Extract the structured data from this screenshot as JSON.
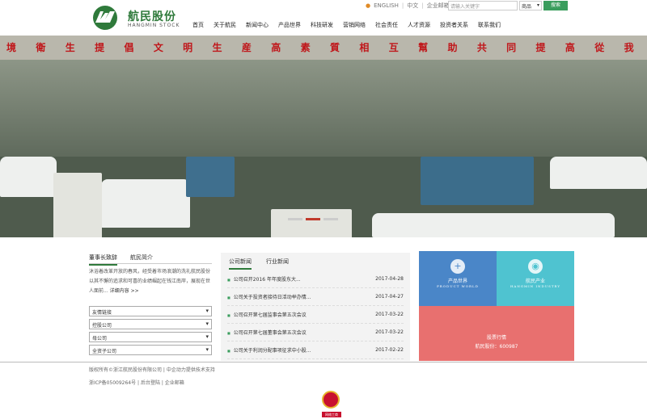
{
  "brand": {
    "name": "航民股份",
    "name_en": "HANGMIN STOCK"
  },
  "toplinks": {
    "english": "ENGLISH",
    "chinese": "中文",
    "email": "企业邮箱"
  },
  "search": {
    "placeholder": "请输入关键字",
    "scope": "商品",
    "button": "搜索"
  },
  "nav": [
    "首页",
    "关于航民",
    "新闻中心",
    "产品世界",
    "科技研发",
    "营销网络",
    "社会责任",
    "人才资源",
    "投资者关系",
    "联系我们"
  ],
  "hero": {
    "banner_chars": [
      "境",
      "衛",
      "生",
      "提",
      "倡",
      "文",
      "明",
      "生",
      "産",
      "高",
      "素",
      "質",
      "相",
      "互",
      "幫",
      "助",
      "共",
      "同",
      "提",
      "高",
      "從",
      "我"
    ]
  },
  "left": {
    "tabs": [
      "董事长致辞",
      "航民简介"
    ],
    "intro": "沐浴着改革开放的春风，经受着市场浪潮的洗礼航民股份以其不懈的追求和可喜的业绩崛起在钱江南岸，展现在世人面前...",
    "more": "详细内容 >>",
    "dropdowns": [
      "友情链接",
      "控股公司",
      "母公司",
      "全资子公司"
    ]
  },
  "news": {
    "tabs": [
      "公司新闻",
      "行业新闻"
    ],
    "items": [
      {
        "title": "公司召开2016 年年度股东大...",
        "date": "2017-04-28"
      },
      {
        "title": "公司关于投资者接待日活动举办情...",
        "date": "2017-04-27"
      },
      {
        "title": "公司召开第七届监事会第五次会议",
        "date": "2017-03-22"
      },
      {
        "title": "公司召开第七届董事会第五次会议",
        "date": "2017-03-22"
      },
      {
        "title": "公司关于利润分配事项征求中小股...",
        "date": "2017-02-22"
      }
    ]
  },
  "tiles": {
    "product": {
      "title": "产品世界",
      "sub": "PRODUCT WORLD",
      "icon": "+"
    },
    "industry": {
      "title": "航民产业",
      "sub": "HANGMIN INDUSTRY",
      "icon": "◉"
    },
    "stock": {
      "title": "股票行情",
      "code": "航民股份：600987"
    }
  },
  "footer": {
    "line1": "版权所有©浙江航民股份有限公司 | 中企动力提供技术支持",
    "line2": "浙ICP备05009264号 | 后台登陆 | 企业邮箱",
    "badge": "网络工商"
  },
  "colors": {
    "brand_green": "#2f7a3b",
    "tile_blue": "#4a86c8",
    "tile_teal": "#4fc3d0",
    "tile_red": "#e8706f"
  }
}
